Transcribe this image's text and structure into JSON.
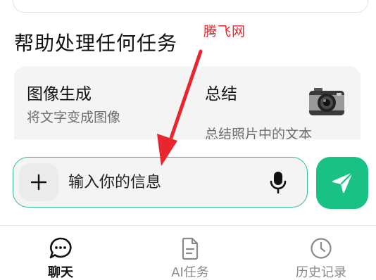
{
  "watermark": "腾飞网",
  "section_title": "帮助处理任何任务",
  "cards": [
    {
      "title": "图像生成",
      "description": "将文字变成图像"
    },
    {
      "title": "总结",
      "description": "总结照片中的文本",
      "icon": "camera-icon"
    }
  ],
  "composer": {
    "placeholder": "输入你的信息",
    "add_icon": "plus-icon",
    "mic_icon": "microphone-icon",
    "send_icon": "send-icon"
  },
  "bottom_nav": [
    {
      "label": "聊天",
      "icon": "chat-bubble-icon",
      "active": true
    },
    {
      "label": "AI任务",
      "icon": "document-icon",
      "active": false
    },
    {
      "label": "历史记录",
      "icon": "clock-icon",
      "active": false
    }
  ],
  "colors": {
    "accent": "#19c185",
    "accent_border": "#2fbf86",
    "annotation": "#e8262f",
    "card_bg": "#f4f4f4"
  }
}
